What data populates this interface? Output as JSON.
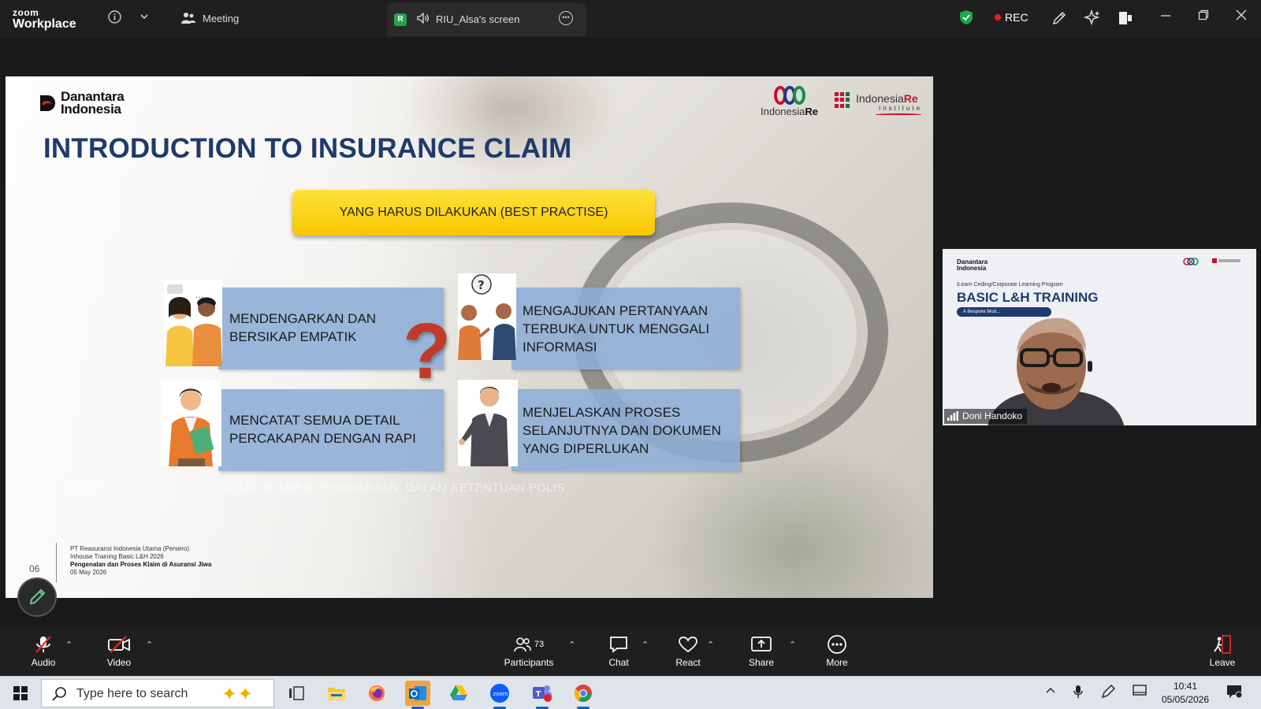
{
  "app": {
    "logo_line1": "zoom",
    "logo_line2": "Workplace",
    "meeting_label": "Meeting",
    "share_badge": "R",
    "share_label": "RIU_Alsa's screen",
    "rec_label": "REC"
  },
  "slide": {
    "brand_left": [
      "Danantara",
      "Indonesia"
    ],
    "brand_right_1": [
      "Indonesia",
      "Re"
    ],
    "brand_right_2": [
      "Indonesia",
      "Re"
    ],
    "brand_right_2_sub": "Institute",
    "title": "INTRODUCTION TO INSURANCE CLAIM",
    "banner": "YANG HARUS DILAKUKAN (BEST PRACTISE)",
    "cards": [
      {
        "text": "MENDENGARKAN DAN BERSIKAP EMPATIK"
      },
      {
        "text": "MENGAJUKAN PERTANYAAN TERBUKA UNTUK MENGGALI INFORMASI"
      },
      {
        "text": "MENCATAT SEMUA DETAIL PERCAKAPAN DENGAN RAPI"
      },
      {
        "text": "MENJELASKAN PROSES SELANJUTNYA DAN DOKUMEN YANG DIPERLUKAN"
      }
    ],
    "faded_text": "INTEGRITAS, REPUTASI, DAN KOMITMEN PERUSAHAAN, DALAM KETENTUAN POLIS",
    "page_number": "06",
    "footer": [
      "PT Reasuransi Indonesia Utama (Persero)",
      "Inhouse Training Basic L&H 2026",
      "Pengenalan dan Proses Klaim di Asuransi Jiwa",
      "05 May 2026"
    ]
  },
  "video_tile": {
    "brand": [
      "Danantara",
      "Indonesia"
    ],
    "subtitle": "iLearn Ceding/Corporate Learning Program",
    "headline": "BASIC L&H TRAINING",
    "pill": "A Bespoke Mod...",
    "participant_name": "Doni Handoko"
  },
  "toolbar": {
    "audio": "Audio",
    "video": "Video",
    "participants": "Participants",
    "participants_count": "73",
    "chat": "Chat",
    "react": "React",
    "share": "Share",
    "more": "More",
    "leave": "Leave"
  },
  "taskbar": {
    "search_placeholder": "Type here to search",
    "time": "10:41",
    "date": "05/05/2026"
  },
  "colors": {
    "title_blue": "#1e3a6e",
    "banner_yellow": "#f7c600",
    "card_blue": "#8dadd6",
    "rec_red": "#e02424",
    "shield_green": "#1fa750"
  }
}
